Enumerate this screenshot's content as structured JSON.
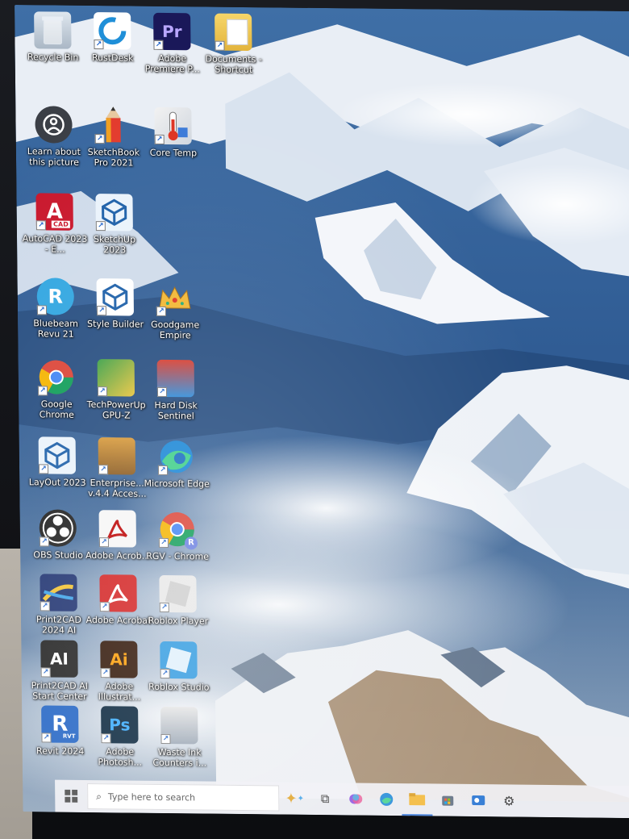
{
  "desktop": {
    "icons": [
      {
        "label": "Recycle Bin",
        "icon": "recycle-bin-icon",
        "col": 0,
        "row": 0
      },
      {
        "label": "RustDesk",
        "icon": "rustdesk-icon",
        "col": 1,
        "row": 0
      },
      {
        "label": "Adobe Premiere P...",
        "icon": "premiere-pro-icon",
        "col": 2,
        "row": 0,
        "badge": "Pr"
      },
      {
        "label": "Documents - Shortcut",
        "icon": "folder-icon",
        "col": 3,
        "row": 0
      },
      {
        "label": "Learn about this picture",
        "icon": "camera-info-icon",
        "col": 0,
        "row": 1
      },
      {
        "label": "SketchBook Pro 2021",
        "icon": "sketchbook-pencil-icon",
        "col": 1,
        "row": 1
      },
      {
        "label": "Core Temp",
        "icon": "thermometer-icon",
        "col": 2,
        "row": 1
      },
      {
        "label": "AutoCAD 2023 - E...",
        "icon": "autocad-icon",
        "col": 0,
        "row": 2,
        "badge": "A"
      },
      {
        "label": "SketchUp 2023",
        "icon": "sketchup-icon",
        "col": 1,
        "row": 2
      },
      {
        "label": "Bluebeam Revu 21",
        "icon": "bluebeam-icon",
        "col": 0,
        "row": 3
      },
      {
        "label": "Style Builder",
        "icon": "style-builder-icon",
        "col": 1,
        "row": 3
      },
      {
        "label": "Goodgame Empire",
        "icon": "crown-icon",
        "col": 2,
        "row": 3
      },
      {
        "label": "Google Chrome",
        "icon": "chrome-icon",
        "col": 0,
        "row": 4
      },
      {
        "label": "TechPowerUp GPU-Z",
        "icon": "gpu-z-icon",
        "col": 1,
        "row": 4
      },
      {
        "label": "Hard Disk Sentinel",
        "icon": "hard-disk-sentinel-icon",
        "col": 2,
        "row": 4
      },
      {
        "label": "LayOut 2023",
        "icon": "layout-icon",
        "col": 0,
        "row": 5
      },
      {
        "label": "Enterprise... v.4.4 Acces...",
        "icon": "enterprise-icon",
        "col": 1,
        "row": 5
      },
      {
        "label": "Microsoft Edge",
        "icon": "edge-icon",
        "col": 2,
        "row": 5
      },
      {
        "label": "OBS Studio",
        "icon": "obs-icon",
        "col": 0,
        "row": 6
      },
      {
        "label": "Adobe Acrob...",
        "icon": "acrobat-white-icon",
        "col": 1,
        "row": 6
      },
      {
        "label": "RGV - Chrome",
        "icon": "chrome-profile-icon",
        "col": 2,
        "row": 6,
        "badge": "R"
      },
      {
        "label": "Print2CAD 2024 AI",
        "icon": "print2cad-icon",
        "col": 0,
        "row": 7
      },
      {
        "label": "Adobe Acrobat",
        "icon": "acrobat-red-icon",
        "col": 1,
        "row": 7
      },
      {
        "label": "Roblox Player",
        "icon": "roblox-player-icon",
        "col": 2,
        "row": 7
      },
      {
        "label": "Print2CAD AI Start Center",
        "icon": "print2cad-ai-icon",
        "col": 0,
        "row": 8,
        "badge": "AI"
      },
      {
        "label": "Adobe Illustrat...",
        "icon": "illustrator-icon",
        "col": 1,
        "row": 8,
        "badge": "Ai"
      },
      {
        "label": "Roblox Studio",
        "icon": "roblox-studio-icon",
        "col": 2,
        "row": 8
      },
      {
        "label": "Revit 2024",
        "icon": "revit-icon",
        "col": 0,
        "row": 9,
        "badge": "R"
      },
      {
        "label": "Adobe Photosh...",
        "icon": "photoshop-icon",
        "col": 1,
        "row": 9,
        "badge": "Ps"
      },
      {
        "label": "Waste Ink Counters i...",
        "icon": "waste-ink-icon",
        "col": 2,
        "row": 9
      }
    ]
  },
  "taskbar": {
    "start_icon": "windows-start-icon",
    "search_placeholder": "Type here to search",
    "pinned": [
      "copilot-icon",
      "task-view-icon",
      "copilot-app-icon",
      "edge-icon",
      "file-explorer-icon",
      "store-icon",
      "outlook-icon",
      "settings-icon"
    ]
  },
  "colors": {
    "taskbar": "#f0f0f4",
    "accent": "#2b6fd6"
  }
}
